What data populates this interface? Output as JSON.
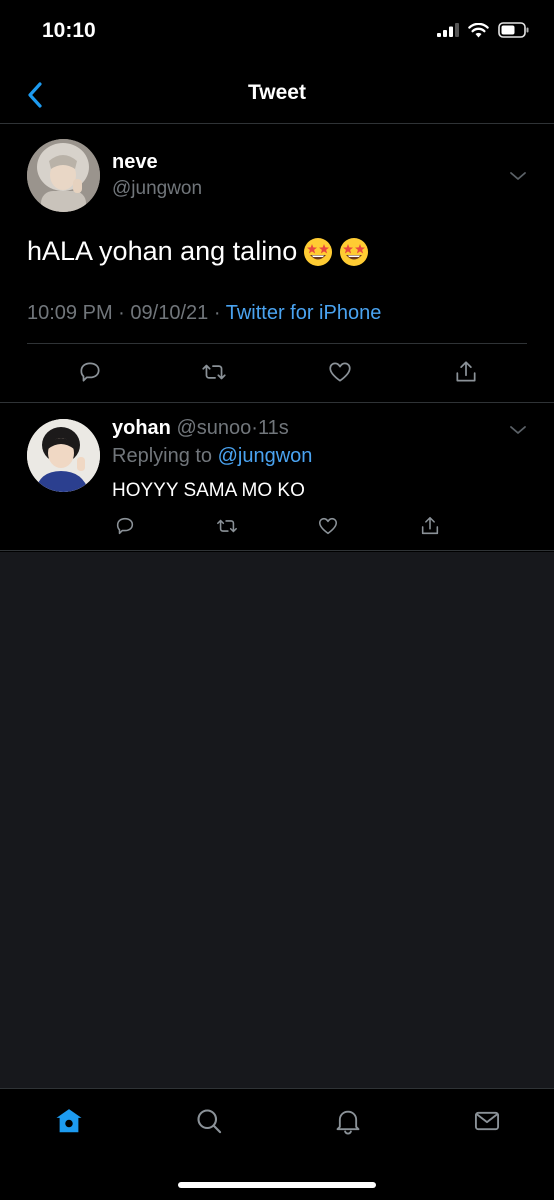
{
  "status_bar": {
    "time": "10:10"
  },
  "nav": {
    "title": "Tweet"
  },
  "main_tweet": {
    "name": "neve",
    "handle": "@jungwon",
    "text": "hALA yohan ang talino",
    "emoji": [
      "star-struck-emoji",
      "star-struck-emoji"
    ],
    "time": "10:09 PM",
    "date": "09/10/21",
    "separator": "·",
    "source": "Twitter for iPhone"
  },
  "reply": {
    "name": "yohan",
    "handle": "@sunoo",
    "separator": "·",
    "age": "11s",
    "replying_label": "Replying to",
    "replying_handle": "@jungwon",
    "text": "HOYYY SAMA MO KO"
  },
  "tab_bar": {
    "tabs": [
      "home-icon",
      "search-icon",
      "bell-icon",
      "mail-icon"
    ],
    "active": "home-icon"
  },
  "colors": {
    "accent": "#1d9bf0",
    "link": "#4aa3f0",
    "muted": "#71767b",
    "background": "#000000",
    "empty_area": "#17181c"
  }
}
